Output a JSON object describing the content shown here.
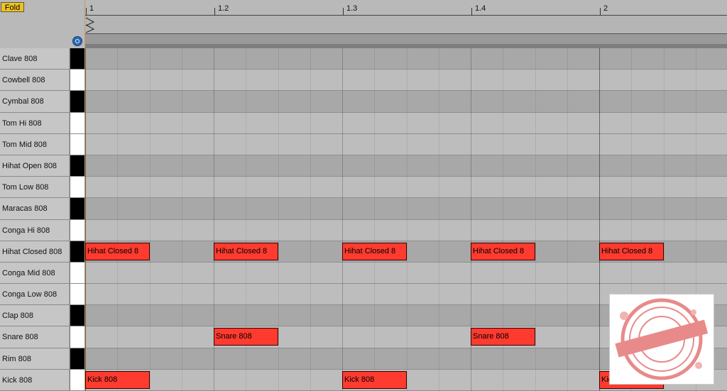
{
  "toolbar": {
    "fold_label": "Fold"
  },
  "ruler": {
    "labels": [
      "1",
      "1.2",
      "1.3",
      "1.4",
      "2"
    ]
  },
  "keys": [
    {
      "name": "Clave 808",
      "color": "black"
    },
    {
      "name": "Cowbell 808",
      "color": "white"
    },
    {
      "name": "Cymbal 808",
      "color": "black"
    },
    {
      "name": "Tom Hi 808",
      "color": "white"
    },
    {
      "name": "Tom Mid 808",
      "color": "white"
    },
    {
      "name": "Hihat Open 808",
      "color": "black"
    },
    {
      "name": "Tom Low 808",
      "color": "white"
    },
    {
      "name": "Maracas 808",
      "color": "black"
    },
    {
      "name": "Conga Hi 808",
      "color": "white"
    },
    {
      "name": "Hihat Closed 808",
      "color": "black"
    },
    {
      "name": "Conga Mid 808",
      "color": "white"
    },
    {
      "name": "Conga Low 808",
      "color": "white"
    },
    {
      "name": "Clap 808",
      "color": "black"
    },
    {
      "name": "Snare 808",
      "color": "white"
    },
    {
      "name": "Rim 808",
      "color": "black"
    },
    {
      "name": "Kick 808",
      "color": "white"
    }
  ],
  "notes": [
    {
      "label": "Hihat Closed 8",
      "row": 9,
      "start": 0,
      "length": 0.5
    },
    {
      "label": "Hihat Closed 8",
      "row": 9,
      "start": 1,
      "length": 0.5
    },
    {
      "label": "Hihat Closed 8",
      "row": 9,
      "start": 2,
      "length": 0.5
    },
    {
      "label": "Hihat Closed 8",
      "row": 9,
      "start": 3,
      "length": 0.5
    },
    {
      "label": "Hihat Closed 8",
      "row": 9,
      "start": 4,
      "length": 0.5
    },
    {
      "label": "Snare 808",
      "row": 13,
      "start": 1,
      "length": 0.5
    },
    {
      "label": "Snare 808",
      "row": 13,
      "start": 3,
      "length": 0.5
    },
    {
      "label": "Kick 808",
      "row": 15,
      "start": 0,
      "length": 0.5
    },
    {
      "label": "Kick 808",
      "row": 15,
      "start": 2,
      "length": 0.5
    },
    {
      "label": "Kic",
      "row": 15,
      "start": 4,
      "length": 0.5
    }
  ],
  "colors": {
    "note": "#ff3b2f",
    "fold": "#f0c419",
    "preview": "#2a6bb3"
  },
  "icons": {
    "preview": "headphones-icon",
    "loop": "loop-marker-icon"
  }
}
